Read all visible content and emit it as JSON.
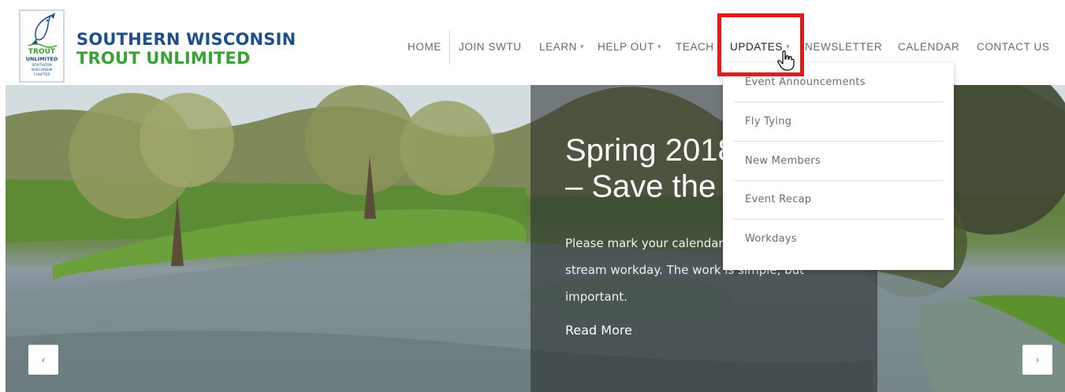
{
  "logo": {
    "badge_lines": [
      "TROUT",
      "UNLIMITED",
      "SOUTHERN",
      "WISCONSIN",
      "CHAPTER"
    ],
    "line1": "SOUTHERN WISCONSIN",
    "line2": "TROUT UNLIMITED"
  },
  "nav": {
    "items": [
      {
        "label": "HOME",
        "dropdown": false
      },
      {
        "label": "JOIN SWTU",
        "dropdown": false
      },
      {
        "label": "LEARN",
        "dropdown": true
      },
      {
        "label": "HELP OUT",
        "dropdown": true
      },
      {
        "label": "TEACH",
        "dropdown": false
      },
      {
        "label": "UPDATES",
        "dropdown": true,
        "active": true
      },
      {
        "label": "NEWSLETTER",
        "dropdown": false
      },
      {
        "label": "CALENDAR",
        "dropdown": false
      },
      {
        "label": "CONTACT US",
        "dropdown": false
      }
    ],
    "caret": "▾"
  },
  "dropdown": {
    "items": [
      "Event Announcements",
      "Fly Tying",
      "New Members",
      "Event Recap",
      "Workdays"
    ]
  },
  "hero": {
    "title_line1": "Spring 2018",
    "title_line2": "– Save the",
    "body_line1": "Please mark your calendar",
    "body_line2": "stream workday.  The work is simple, but",
    "body_line3": "important.",
    "read_more": "Read More",
    "prev_icon": "chevron-left-icon",
    "next_icon": "chevron-right-icon",
    "prev_glyph": "‹",
    "next_glyph": "›"
  },
  "colors": {
    "brand_blue": "#1f4e8c",
    "brand_green": "#3aa135",
    "highlight_red": "#e01b1b"
  }
}
